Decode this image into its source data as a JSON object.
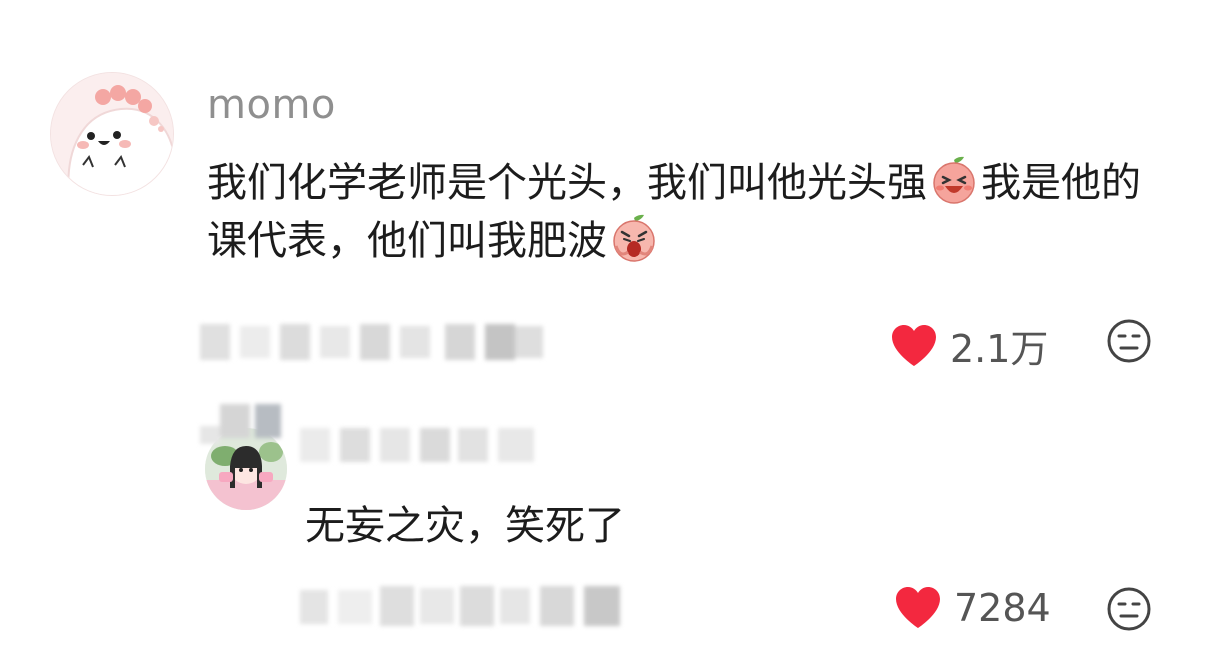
{
  "comment": {
    "username": "momo",
    "text_part1": "我们化学老师是个光头，我们叫他光头强",
    "text_part2": "我是他的课代表，他们叫我肥波",
    "emoji_1": "laughing-radish-emoji",
    "emoji_2": "crying-radish-emoji",
    "like_count": "2.1万"
  },
  "reply": {
    "text": "无妄之灾，笑死了",
    "like_count": "7284"
  },
  "colors": {
    "heart": "#f3283f",
    "username": "#8f8f8f",
    "text": "#1c1c1c",
    "count": "#555555"
  }
}
